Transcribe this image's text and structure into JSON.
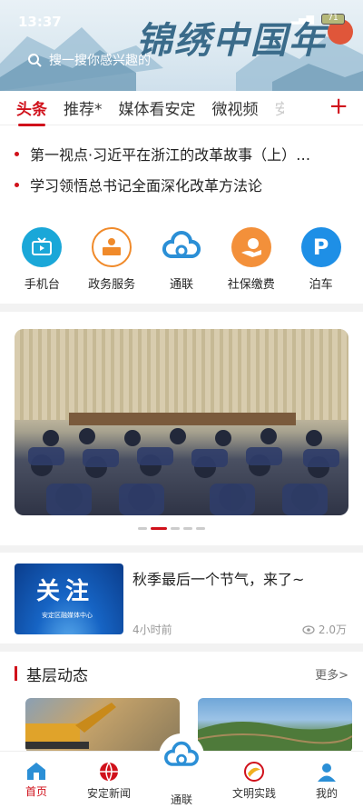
{
  "status": {
    "time": "13:37",
    "battery": "71"
  },
  "header": {
    "banner_title": "锦绣中国年",
    "search_placeholder": "搜一搜你感兴趣的"
  },
  "tabs": [
    {
      "label": "头条",
      "active": true
    },
    {
      "label": "推荐*"
    },
    {
      "label": "媒体看安定"
    },
    {
      "label": "微视频"
    },
    {
      "label": "安"
    }
  ],
  "add_tab_icon": "plus-icon",
  "headlines": [
    "第一视点·习近平在浙江的改革故事（上）…",
    "学习领悟总书记全面深化改革方法论"
  ],
  "services": [
    {
      "label": "手机台",
      "icon": "tv-icon",
      "color": "#1aa7d8"
    },
    {
      "label": "政务服务",
      "icon": "government-service-icon",
      "color": "#f08a2a"
    },
    {
      "label": "通联",
      "icon": "cloud-link-icon",
      "color": "#2b8fd6"
    },
    {
      "label": "社保缴费",
      "icon": "social-security-payment-icon",
      "color": "#f3903a"
    },
    {
      "label": "泊车",
      "icon": "parking-icon",
      "color": "#1e8fe6"
    }
  ],
  "carousel": {
    "total_slides": 5,
    "active_index": 1
  },
  "feature_news": {
    "image_text": "关注",
    "image_caption": "安定区融媒体中心",
    "title": "秋季最后一个节气，来了~",
    "time": "4小时前",
    "views": "2.0万"
  },
  "section": {
    "title": "基层动态",
    "more": "更多>"
  },
  "bottom_nav": [
    {
      "label": "首页",
      "icon": "home-icon",
      "active": true
    },
    {
      "label": "安定新闻",
      "icon": "globe-icon"
    },
    {
      "label": "通联",
      "icon": "cloud-link-icon"
    },
    {
      "label": "文明实践",
      "icon": "civilization-practice-icon"
    },
    {
      "label": "我的",
      "icon": "user-icon"
    }
  ],
  "colors": {
    "accent": "#d0111b"
  }
}
